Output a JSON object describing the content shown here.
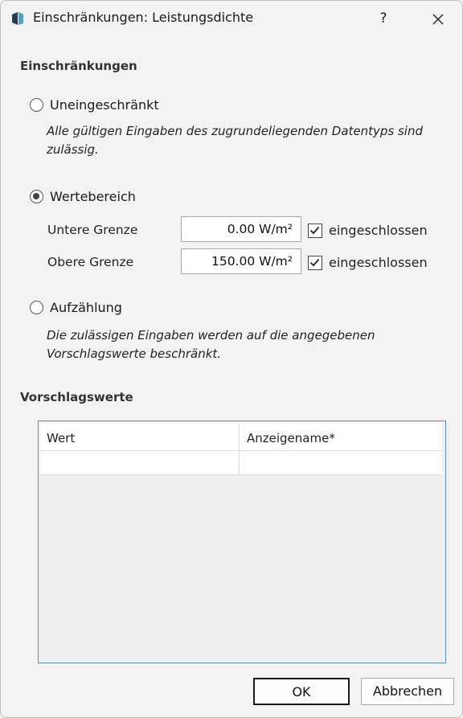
{
  "window": {
    "title": "Einschränkungen: Leistungsdichte",
    "help_label": "?"
  },
  "constraints": {
    "heading": "Einschränkungen",
    "unrestricted": {
      "label": "Uneingeschränkt",
      "selected": false,
      "description_line1": "Alle gültigen Eingaben des zugrundeliegenden Datentyps sind",
      "description_line2": "zulässig."
    },
    "range": {
      "label": "Wertebereich",
      "selected": true,
      "lower": {
        "label": "Untere Grenze",
        "value": "0.00 W/m²",
        "included_label": "eingeschlossen",
        "included": true
      },
      "upper": {
        "label": "Obere Grenze",
        "value": "150.00 W/m²",
        "included_label": "eingeschlossen",
        "included": true
      }
    },
    "enumeration": {
      "label": "Aufzählung",
      "selected": false,
      "description_line1": "Die zulässigen Eingaben werden auf die angegebenen",
      "description_line2": "Vorschlagswerte beschränkt."
    }
  },
  "suggestions": {
    "heading": "Vorschlagswerte",
    "columns": [
      "Wert",
      "Anzeigename*"
    ],
    "rows": [
      [
        "",
        ""
      ]
    ]
  },
  "buttons": {
    "ok": "OK",
    "cancel": "Abbrechen"
  }
}
